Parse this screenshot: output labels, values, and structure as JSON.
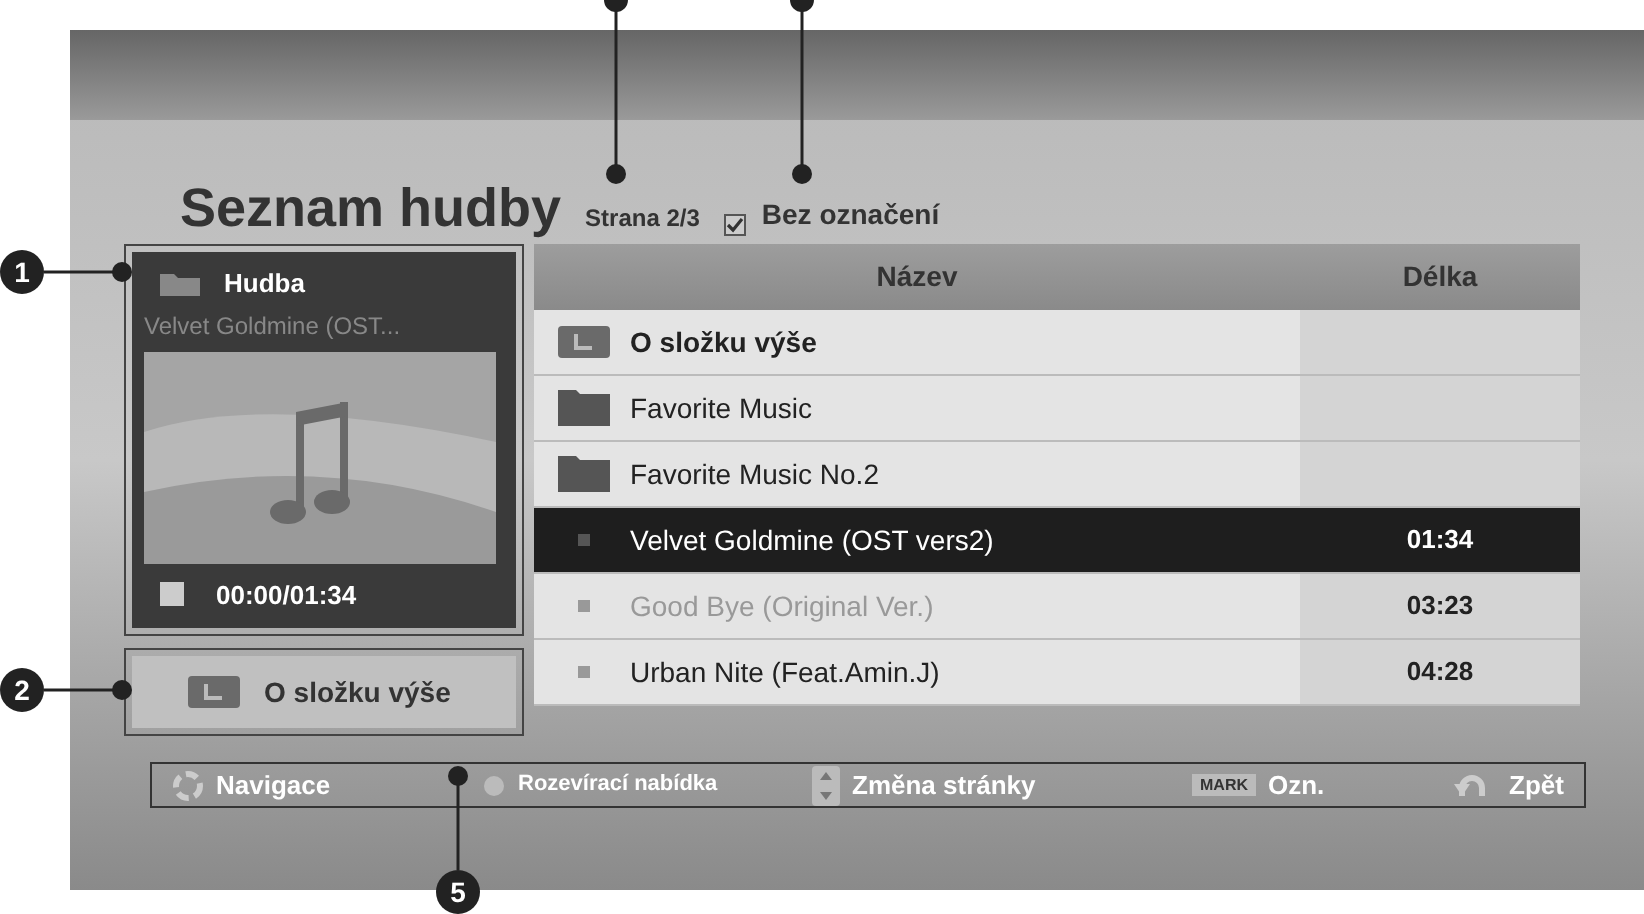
{
  "title": "Seznam hudby",
  "page": "Strana 2/3",
  "mark_filter": {
    "label": "Bez označení",
    "checked": true
  },
  "now_playing": {
    "header": "Hudba",
    "track": "Velvet Goldmine (OST...",
    "time": "00:00/01:34"
  },
  "up_button": "O složku výše",
  "table": {
    "columns": [
      "Název",
      "Délka"
    ],
    "rows": [
      {
        "kind": "up",
        "name": "O složku výše",
        "selected": false,
        "disabled": false
      },
      {
        "kind": "folder",
        "name": "Favorite Music",
        "selected": false,
        "disabled": false
      },
      {
        "kind": "folder",
        "name": "Favorite Music No.2",
        "selected": false,
        "disabled": false
      },
      {
        "kind": "song",
        "name": "Velvet Goldmine (OST vers2)",
        "duration": "01:34",
        "selected": true,
        "disabled": false
      },
      {
        "kind": "song",
        "name": "Good Bye (Original Ver.)",
        "duration": "03:23",
        "selected": false,
        "disabled": true
      },
      {
        "kind": "song",
        "name": "Urban Nite (Feat.Amin.J)",
        "duration": "04:28",
        "selected": false,
        "disabled": false
      }
    ]
  },
  "footer": [
    {
      "kind": "nav",
      "label": "Navigace"
    },
    {
      "kind": "dot",
      "label": "Rozevírací nabídka"
    },
    {
      "kind": "page",
      "label": "Změna stránky"
    },
    {
      "kind": "mark",
      "key": "MARK",
      "label": "Ozn."
    },
    {
      "kind": "back",
      "label": "Zpět"
    }
  ],
  "callouts": [
    {
      "number": "1"
    },
    {
      "number": "2"
    },
    {
      "number": "5"
    }
  ]
}
